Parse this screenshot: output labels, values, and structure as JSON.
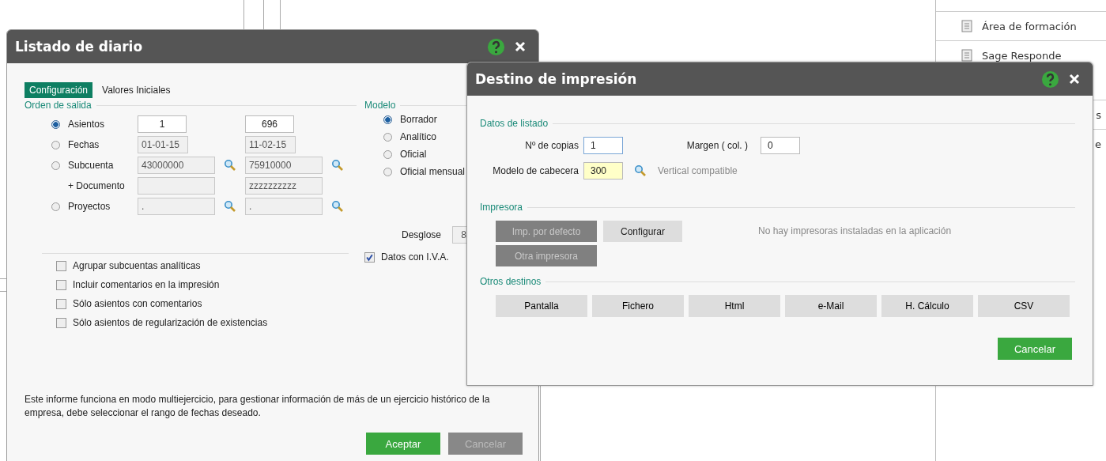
{
  "side_panel": {
    "items": [
      {
        "label": "Área de formación",
        "kind": "icon"
      },
      {
        "label": "Sage Responde",
        "kind": "icon"
      },
      {
        "label": "s",
        "kind": "bare"
      },
      {
        "label": "e",
        "kind": "bare"
      }
    ]
  },
  "listado": {
    "title": "Listado de diario",
    "tabs": [
      {
        "label": "Configuración",
        "selected": true
      },
      {
        "label": "Valores Iniciales",
        "selected": false
      }
    ],
    "orden": {
      "title": "Orden de salida",
      "rows": [
        {
          "label": "Asientos",
          "kind": "radio",
          "selected": true,
          "from": {
            "value": "1",
            "disabled": false
          },
          "to": {
            "value": "696",
            "disabled": false
          },
          "search": false
        },
        {
          "label": "Fechas",
          "kind": "radio",
          "selected": false,
          "from": {
            "value": "01-01-15",
            "disabled": true
          },
          "to": {
            "value": "11-02-15",
            "disabled": true
          },
          "search": false
        },
        {
          "label": "Subcuenta",
          "kind": "radio",
          "selected": false,
          "from": {
            "value": "43000000",
            "disabled": true
          },
          "to": {
            "value": "75910000",
            "disabled": true
          },
          "search": true
        },
        {
          "label": "+ Documento",
          "kind": "plain",
          "from": {
            "disabled": true
          },
          "to": {
            "value": "zzzzzzzzzz",
            "disabled": true
          },
          "search": false
        },
        {
          "label": "Proyectos",
          "kind": "radio",
          "selected": false,
          "from": {
            "value": ".",
            "disabled": true
          },
          "to": {
            "value": ".",
            "disabled": true
          },
          "search": true
        }
      ]
    },
    "modelo": {
      "title": "Modelo",
      "options": [
        {
          "label": "Borrador",
          "selected": true
        },
        {
          "label": "Analítico",
          "selected": false
        },
        {
          "label": "Oficial",
          "selected": false
        },
        {
          "label": "Oficial mensual",
          "selected": false
        }
      ]
    },
    "desglose": {
      "label": "Desglose",
      "value": "8"
    },
    "checks": [
      {
        "label": "Agrupar subcuentas analíticas",
        "checked": false
      },
      {
        "label": "Incluir comentarios en la impresión",
        "checked": false
      },
      {
        "label": "Sólo asientos con comentarios",
        "checked": false
      },
      {
        "label": "Sólo asientos de regularización de existencias",
        "checked": false
      }
    ],
    "iva": {
      "label": "Datos con I.V.A.",
      "checked": true
    },
    "note": "Este informe funciona en modo multiejercicio, para gestionar información de más de un ejercicio histórico de la empresa, debe seleccionar el rango de fechas deseado.",
    "buttons": [
      {
        "label": "Aceptar",
        "disabled": false
      },
      {
        "label": "Cancelar",
        "disabled": true
      }
    ]
  },
  "destino": {
    "title": "Destino de impresión",
    "datos": {
      "title": "Datos de listado",
      "copias": {
        "label": "Nº de copias",
        "value": "1"
      },
      "margen": {
        "label": "Margen ( col. )",
        "value": "0"
      },
      "cabecera": {
        "label": "Modelo de cabecera",
        "value": "300",
        "hint": "Vertical compatible"
      }
    },
    "impresora": {
      "title": "Impresora",
      "buttons": [
        {
          "label": "Imp. por defecto",
          "disabled": true
        },
        {
          "label": "Configurar",
          "disabled": false
        },
        {
          "label": "Otra impresora",
          "disabled": true
        }
      ],
      "message": "No hay impresoras instaladas en la aplicación"
    },
    "otros": {
      "title": "Otros destinos",
      "buttons": [
        "Pantalla",
        "Fichero",
        "Html",
        "e-Mail",
        "H. Cálculo",
        "CSV"
      ]
    },
    "cancel": "Cancelar"
  }
}
